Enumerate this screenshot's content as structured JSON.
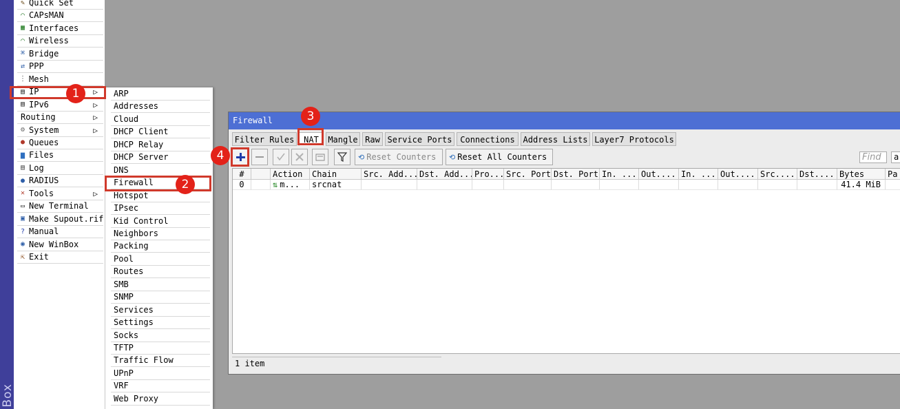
{
  "app": {
    "vertical_label": "Box"
  },
  "main_menu": [
    {
      "label": "Quick Set",
      "icon": "quick-set-icon"
    },
    {
      "label": "CAPsMAN",
      "icon": "capsman-icon"
    },
    {
      "label": "Interfaces",
      "icon": "interfaces-icon"
    },
    {
      "label": "Wireless",
      "icon": "wireless-icon"
    },
    {
      "label": "Bridge",
      "icon": "bridge-icon"
    },
    {
      "label": "PPP",
      "icon": "ppp-icon"
    },
    {
      "label": "Mesh",
      "icon": "mesh-icon"
    },
    {
      "label": "IP",
      "icon": "ip-icon"
    },
    {
      "label": "IPv6",
      "icon": "ipv6-icon"
    },
    {
      "label": "Routing",
      "icon": ""
    },
    {
      "label": "System",
      "icon": "gear-icon"
    },
    {
      "label": "Queues",
      "icon": "queues-icon"
    },
    {
      "label": "Files",
      "icon": "folder-icon"
    },
    {
      "label": "Log",
      "icon": "log-icon"
    },
    {
      "label": "RADIUS",
      "icon": "radius-icon"
    },
    {
      "label": "Tools",
      "icon": "tools-icon"
    },
    {
      "label": "New Terminal",
      "icon": "terminal-icon"
    },
    {
      "label": "Make Supout.rif",
      "icon": "supout-icon"
    },
    {
      "label": "Manual",
      "icon": "manual-icon"
    },
    {
      "label": "New WinBox",
      "icon": "winbox-icon"
    },
    {
      "label": "Exit",
      "icon": "exit-icon"
    }
  ],
  "ip_submenu": [
    "ARP",
    "Addresses",
    "Cloud",
    "DHCP Client",
    "DHCP Relay",
    "DHCP Server",
    "DNS",
    "Firewall",
    "Hotspot",
    "IPsec",
    "Kid Control",
    "Neighbors",
    "Packing",
    "Pool",
    "Routes",
    "SMB",
    "SNMP",
    "Services",
    "Settings",
    "Socks",
    "TFTP",
    "Traffic Flow",
    "UPnP",
    "VRF",
    "Web Proxy"
  ],
  "annotations": {
    "step1": "1",
    "step2": "2",
    "step3": "3",
    "step4": "4"
  },
  "firewall": {
    "title": "Firewall",
    "tabs": [
      "Filter Rules",
      "NAT",
      "Mangle",
      "Raw",
      "Service Ports",
      "Connections",
      "Address Lists",
      "Layer7 Protocols"
    ],
    "active_tab": "NAT",
    "toolbar": {
      "reset_counters": "Reset Counters",
      "reset_all_counters": "Reset All Counters",
      "find_placeholder": "Find",
      "filter_value": "a"
    },
    "columns": [
      "#",
      "",
      "Action",
      "Chain",
      "Src. Add...",
      "Dst. Add...",
      "Pro...",
      "Src. Port",
      "Dst. Port",
      "In. ...",
      "Out....",
      "In. ...",
      "Out....",
      "Src....",
      "Dst....",
      "Bytes",
      "Pa"
    ],
    "rows": [
      [
        "0",
        "",
        "m...",
        "srcnat",
        "",
        "",
        "",
        "",
        "",
        "",
        "",
        "",
        "",
        "",
        "",
        "41.4 MiB",
        ""
      ]
    ],
    "status": "1 item"
  },
  "colors": {
    "accent": "#4d6fd4",
    "highlight": "#d0392b",
    "badge": "#e32219",
    "desktop": "#9e9e9e"
  }
}
